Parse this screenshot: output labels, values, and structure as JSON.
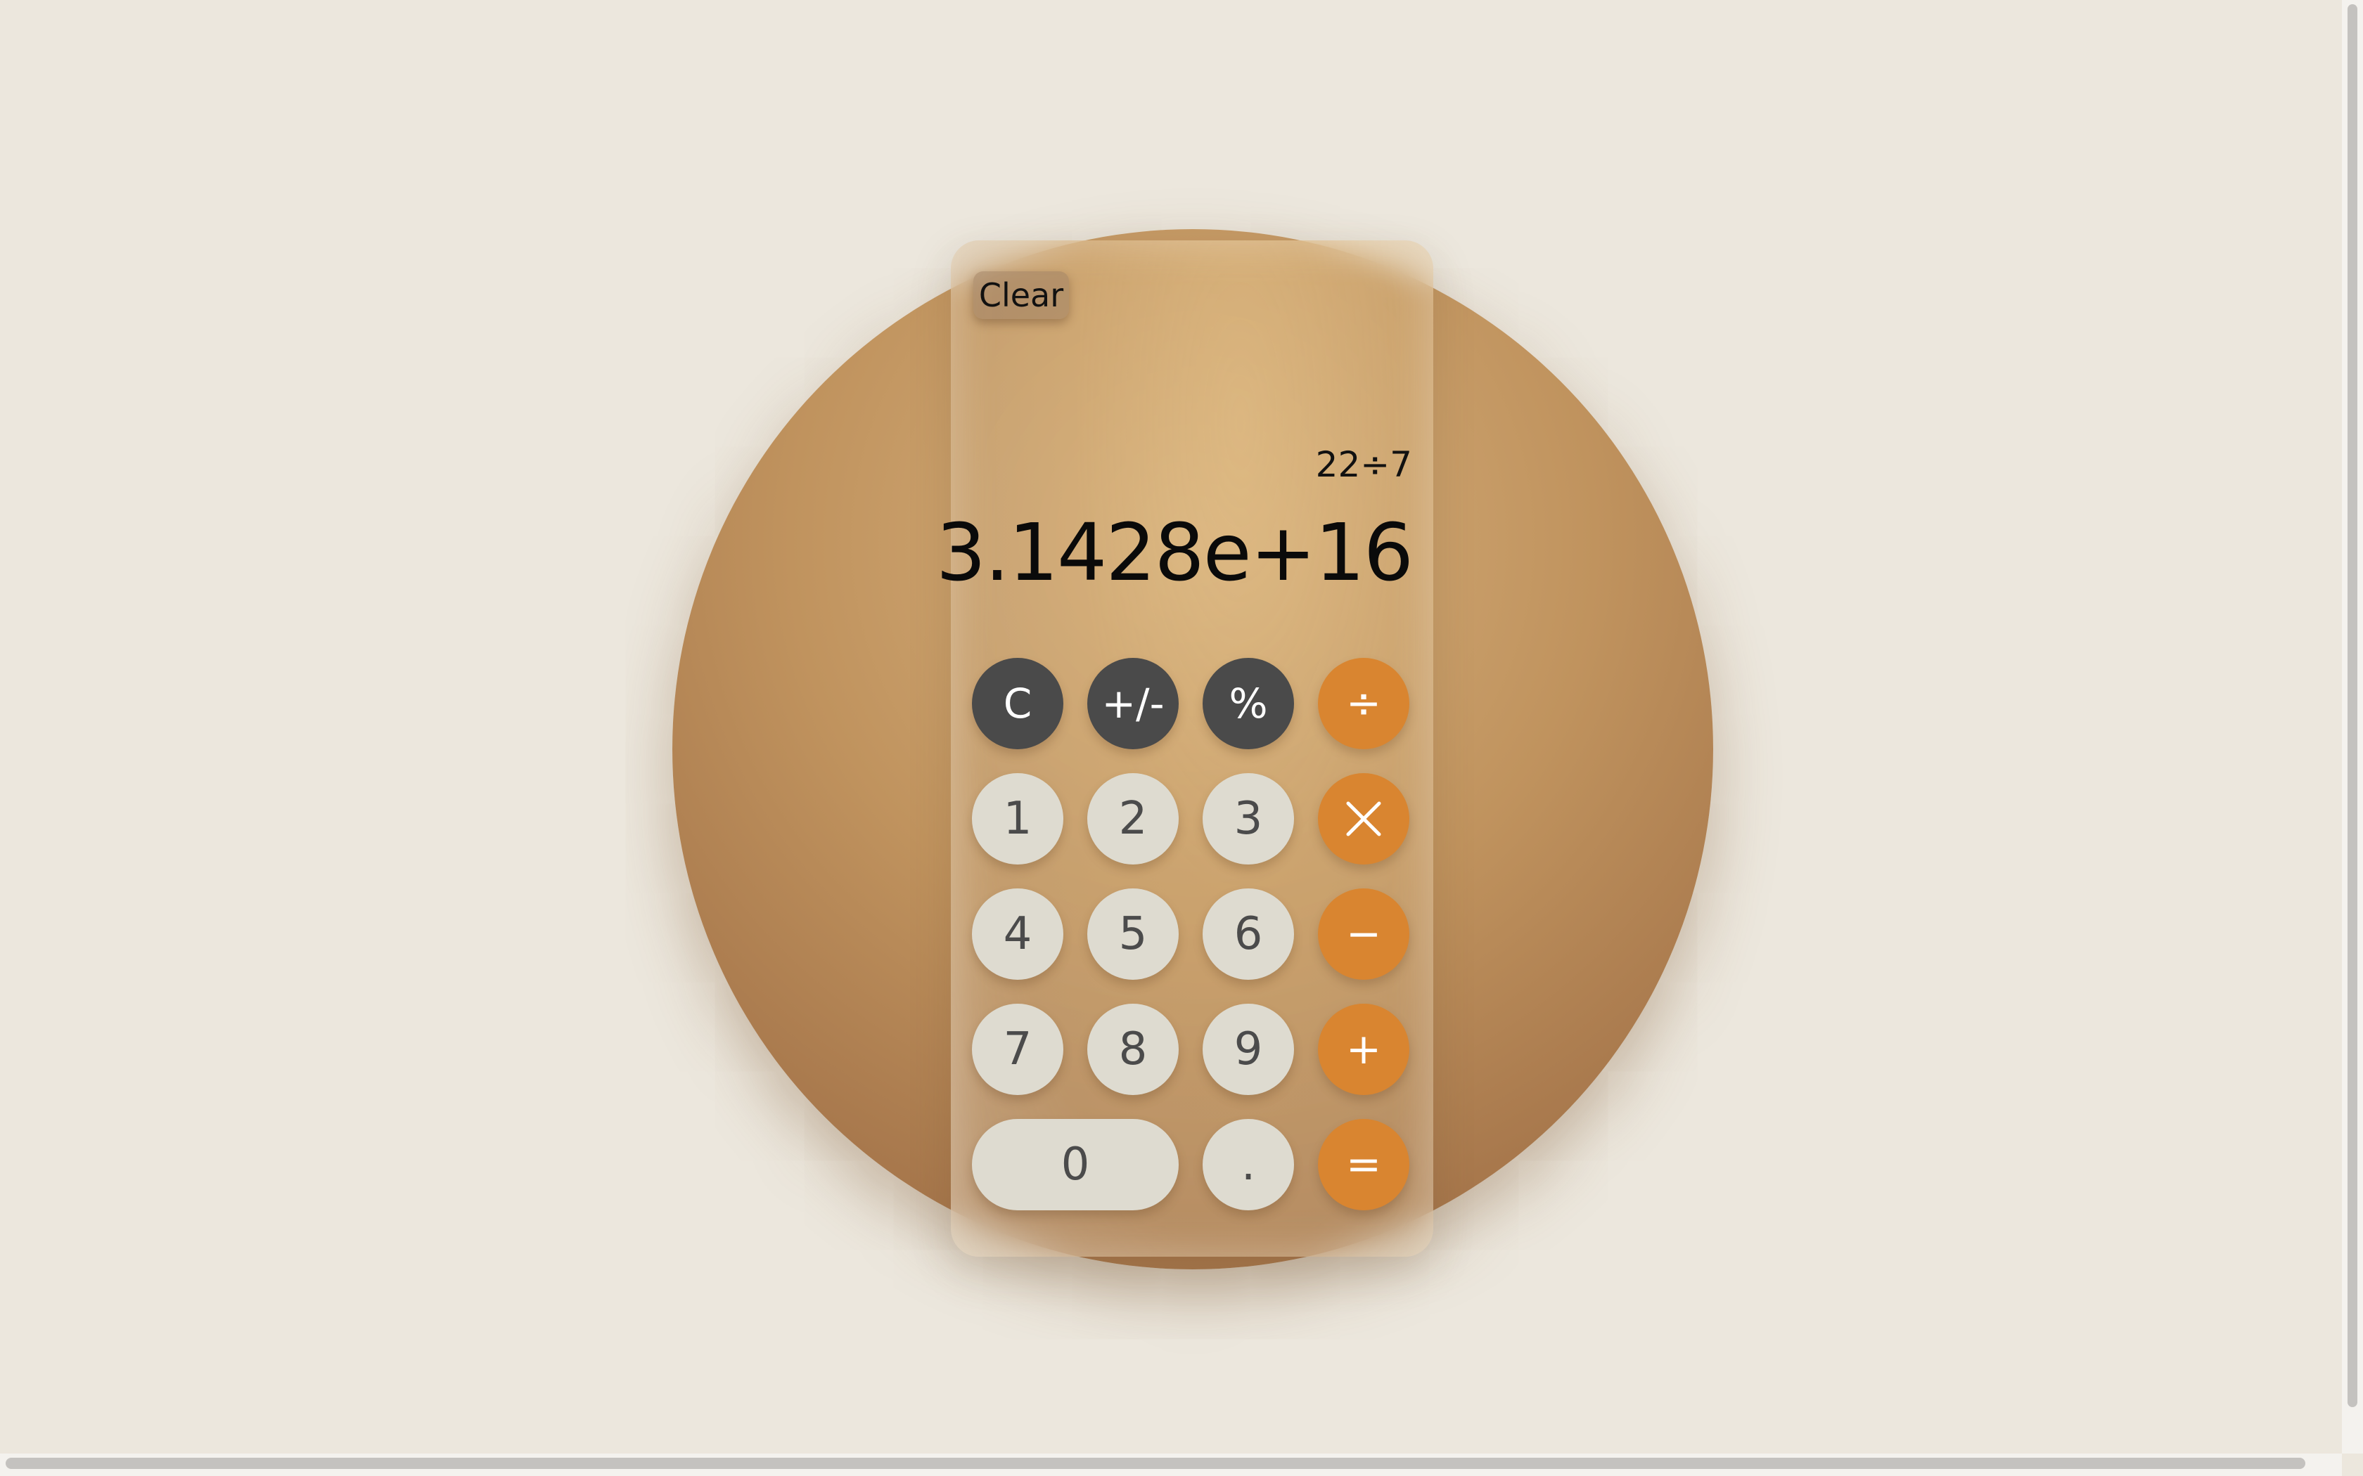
{
  "header": {
    "clear_label": "Clear"
  },
  "display": {
    "expression": "22÷7",
    "result": "3.1428e+16"
  },
  "keypad": {
    "row1": {
      "c": "C",
      "sign": "+/-",
      "percent": "%",
      "divide": "÷"
    },
    "row2": {
      "one": "1",
      "two": "2",
      "three": "3"
    },
    "row3": {
      "four": "4",
      "five": "5",
      "six": "6",
      "minus": "−"
    },
    "row4": {
      "seven": "7",
      "eight": "8",
      "nine": "9",
      "plus": "+"
    },
    "row5": {
      "zero": "0",
      "dot": ".",
      "equals": "="
    }
  },
  "icons": {
    "multiply": "multiply-icon"
  },
  "colors": {
    "background": "#ece7dd",
    "function_key": "#4a4a4a",
    "number_key": "#dedbd0",
    "operator_key": "#d98530",
    "orb": "#b98a58"
  }
}
